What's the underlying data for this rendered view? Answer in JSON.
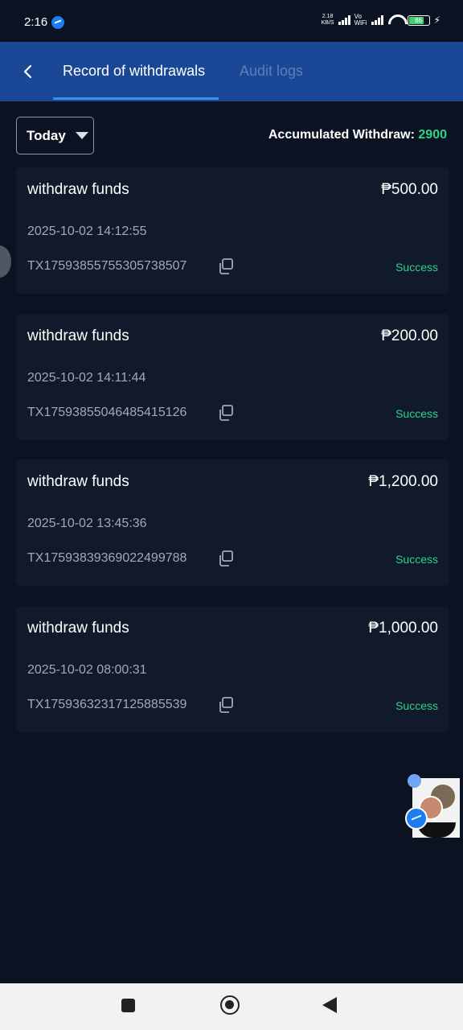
{
  "status_bar": {
    "time": "2:16",
    "speed_value": "2.18",
    "speed_unit": "KB/S",
    "network_label_top": "Vo",
    "network_label_bottom": "WiFi",
    "battery": "86",
    "icons": [
      "messenger-icon",
      "signal-icon",
      "wifi-icon",
      "battery-icon",
      "charging-icon"
    ]
  },
  "header": {
    "tabs": [
      {
        "label": "Record of withdrawals",
        "active": true
      },
      {
        "label": "Audit logs",
        "active": false
      }
    ],
    "colors": {
      "background": "#1a4896",
      "active_tab": "#ffffff",
      "inactive_tab": "#5d7fb8",
      "underline": "#3a8ff5"
    }
  },
  "filter": {
    "selected": "Today"
  },
  "summary": {
    "label": "Accumulated Withdraw:",
    "value": "2900",
    "value_color": "#2ed28a"
  },
  "records": [
    {
      "title": "withdraw funds",
      "amount": "₱500.00",
      "datetime": "2025-10-02 14:12:55",
      "tx_id": "TX17593855755305738507",
      "status": "Success"
    },
    {
      "title": "withdraw funds",
      "amount": "₱200.00",
      "datetime": "2025-10-02 14:11:44",
      "tx_id": "TX17593855046485415126",
      "status": "Success"
    },
    {
      "title": "withdraw funds",
      "amount": "₱1,200.00",
      "datetime": "2025-10-02 13:45:36",
      "tx_id": "TX17593839369022499788",
      "status": "Success"
    },
    {
      "title": "withdraw funds",
      "amount": "₱1,000.00",
      "datetime": "2025-10-02 08:00:31",
      "tx_id": "TX17593632317125885539",
      "status": "Success"
    }
  ],
  "nav_bar": {
    "icons": [
      "recents-square-icon",
      "home-circle-icon",
      "back-triangle-icon"
    ]
  }
}
